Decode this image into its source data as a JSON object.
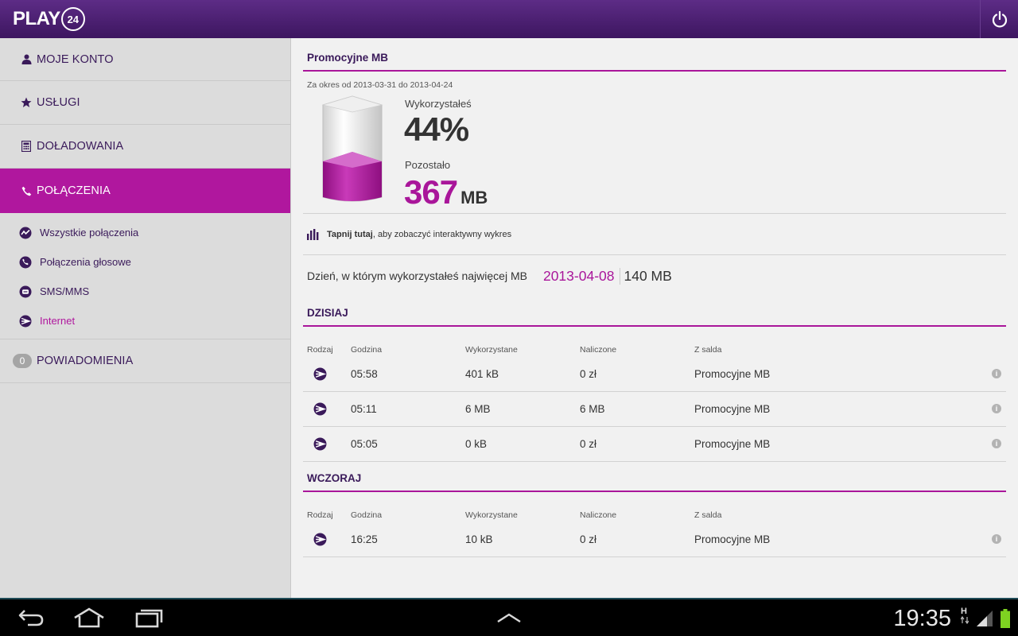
{
  "app": {
    "logo_text": "PLAY",
    "logo_number": "24"
  },
  "colors": {
    "accent": "#a9169a",
    "header": "#4a1e70",
    "menu_text": "#3a1a5a"
  },
  "sidebar": {
    "items": [
      {
        "label": "MOJE KONTO",
        "icon": "user-icon"
      },
      {
        "label": "USŁUGI",
        "icon": "star-icon"
      },
      {
        "label": "DOŁADOWANIA",
        "icon": "calculator-icon"
      },
      {
        "label": "POŁĄCZENIA",
        "icon": "phone-icon",
        "active": true
      }
    ],
    "subitems": [
      {
        "label": "Wszystkie połączenia",
        "icon": "activity-icon"
      },
      {
        "label": "Połączenia głosowe",
        "icon": "phone-circle-icon"
      },
      {
        "label": "SMS/MMS",
        "icon": "message-icon"
      },
      {
        "label": "Internet",
        "icon": "internet-icon",
        "current": true
      }
    ],
    "notifications": {
      "label": "POWIADOMIENIA",
      "count": "0"
    }
  },
  "promo": {
    "title": "Promocyjne MB",
    "period": "Za okres od 2013-03-31 do 2013-04-24",
    "used_label": "Wykorzystałeś",
    "used_pct": "44%",
    "used_fraction": 0.44,
    "left_label": "Pozostało",
    "left_value": "367",
    "left_unit": "MB"
  },
  "tap": {
    "bold": "Tapnij tutaj",
    "rest": ", aby zobaczyć interaktywny wykres"
  },
  "maxday": {
    "label": "Dzień, w którym wykorzystałeś najwięcej MB",
    "date": "2013-04-08",
    "value": "140 MB"
  },
  "columns": {
    "type": "Rodzaj",
    "time": "Godzina",
    "used": "Wykorzystane",
    "charged": "Naliczone",
    "from": "Z salda"
  },
  "today": {
    "title": "DZISIAJ",
    "rows": [
      {
        "time": "05:58",
        "used": "401 kB",
        "charged": "0 zł",
        "from": "Promocyjne MB"
      },
      {
        "time": "05:11",
        "used": "6 MB",
        "charged": "6 MB",
        "from": "Promocyjne MB"
      },
      {
        "time": "05:05",
        "used": "0 kB",
        "charged": "0 zł",
        "from": "Promocyjne MB"
      }
    ]
  },
  "yesterday": {
    "title": "WCZORAJ",
    "rows": [
      {
        "time": "16:25",
        "used": "10 kB",
        "charged": "0 zł",
        "from": "Promocyjne MB"
      }
    ]
  },
  "status": {
    "time": "19:35",
    "network": "H"
  }
}
